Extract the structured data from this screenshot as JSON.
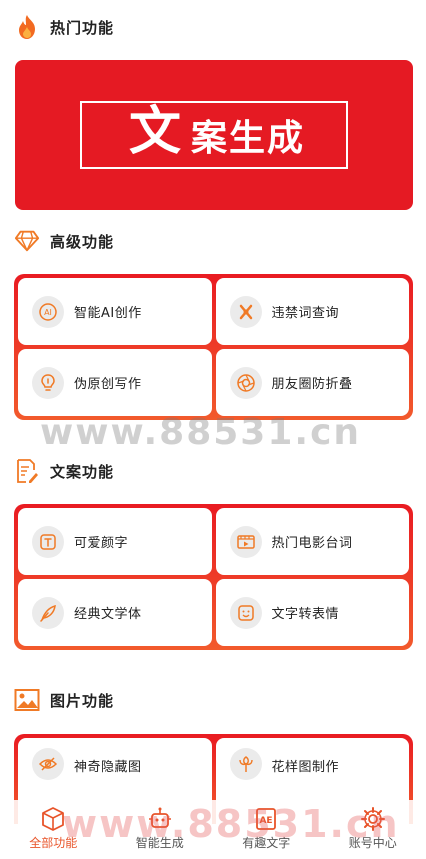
{
  "sections": {
    "hot": {
      "title": "热门功能"
    },
    "advanced": {
      "title": "高级功能"
    },
    "copy": {
      "title": "文案功能"
    },
    "image": {
      "title": "图片功能"
    }
  },
  "banner": {
    "big_char": "文",
    "rest_text": "案生成"
  },
  "advanced_items": [
    {
      "label": "智能AI创作",
      "icon": "ai-icon"
    },
    {
      "label": "违禁词查询",
      "icon": "forbidden-word-icon"
    },
    {
      "label": "伪原创写作",
      "icon": "lightbulb-icon"
    },
    {
      "label": "朋友圈防折叠",
      "icon": "shutter-icon"
    }
  ],
  "copy_items": [
    {
      "label": "可爱颜字",
      "icon": "text-box-icon"
    },
    {
      "label": "热门电影台词",
      "icon": "film-icon"
    },
    {
      "label": "经典文学体",
      "icon": "feather-icon"
    },
    {
      "label": "文字转表情",
      "icon": "smiley-icon"
    }
  ],
  "image_items": [
    {
      "label": "神奇隐藏图",
      "icon": "eye-hidden-icon"
    },
    {
      "label": "花样图制作",
      "icon": "flower-icon"
    }
  ],
  "tabs": [
    {
      "label": "全部功能",
      "icon": "cube-icon",
      "active": true
    },
    {
      "label": "智能生成",
      "icon": "robot-icon",
      "active": false
    },
    {
      "label": "有趣文字",
      "icon": "text-fun-icon",
      "active": false
    },
    {
      "label": "账号中心",
      "icon": "gear-icon",
      "active": false
    }
  ],
  "watermark": {
    "text": "www.88531.cn"
  },
  "colors": {
    "accent": "#e51a23",
    "accent_orange": "#f25a2c",
    "tab_active": "#e8542a"
  }
}
